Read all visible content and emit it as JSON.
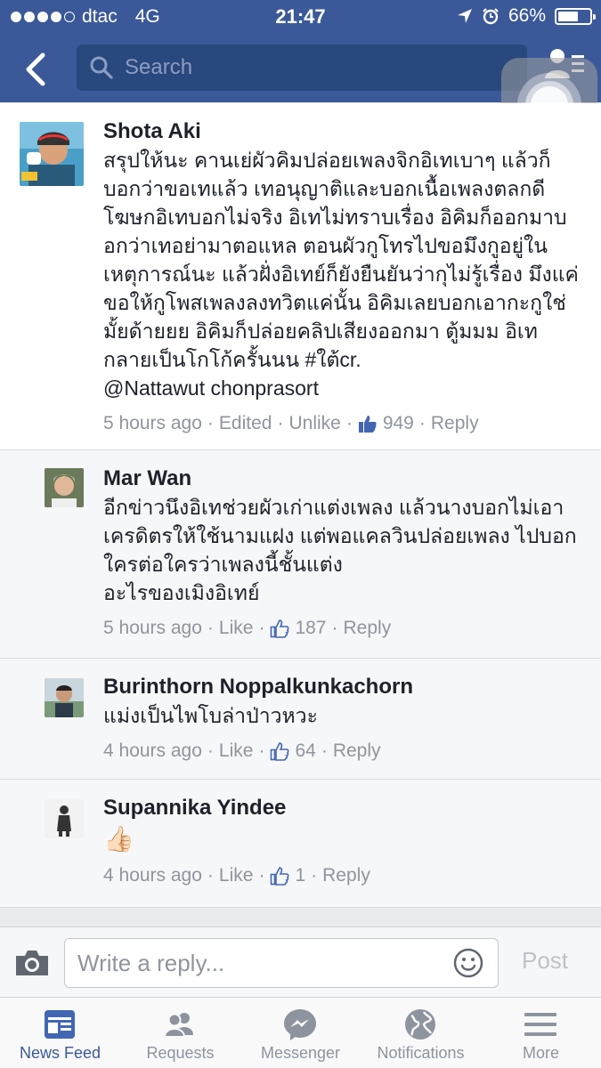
{
  "status_bar": {
    "carrier": "dtac",
    "network": "4G",
    "time": "21:47",
    "battery": "66%",
    "battery_level": 0.66
  },
  "header": {
    "search_placeholder": "Search"
  },
  "comments": [
    {
      "author": "Shota Aki",
      "text": "สรุปให้นะ คานเย่ผัวคิมปล่อยเพลงจิกอิเทเบาๆ แล้วก็บอกว่าขอเทแล้ว เทอนุญาติและบอกเนื้อเพลงตลกดี โฆษกอิเทบอกไม่จริง อิเทไม่ทราบเรื่อง อิคิมก็ออกมาบอกว่าเทอย่ามาตอแหล ตอนผัวกูโทรไปขอมึงกูอยู่ในเหตุการณ์นะ แล้วฝั่งอิเทย์ก็ยังยืนยันว่ากุไม่รู้เรื่อง มึงแค่ขอให้กูโพสเพลงลงทวิตแค่นั้น อิคิมเลยบอกเอากะกูใช่มั้ยด้ายยย อิคิมก็ปล่อยคลิปเสียงออกมา ตู้มมม อิเทกลายเป็นโกโก้ครั้นนน #ใต้cr.",
      "mention": "@Nattawut chonprasort",
      "time": "5 hours ago",
      "edited": "Edited",
      "action": "Unlike",
      "likes": "949",
      "reply": "Reply"
    },
    {
      "author": "Mar Wan",
      "text": "อีกข่าวนึงอิเทช่วยผัวเก่าแต่งเพลง แล้วนางบอกไม่เอาเครดิตรให้ใช้นามแฝง แต่พอแคลวินปล่อยเพลง ไปบอกใครต่อใครว่าเพลงนี้ชั้นแต่ง\nอะไรของเมิงอิเทย์",
      "time": "5 hours ago",
      "action": "Like",
      "likes": "187",
      "reply": "Reply"
    },
    {
      "author": "Burinthorn Noppalkunkachorn",
      "text": "แม่งเป็นไพโบล่าป่าวหวะ",
      "time": "4 hours ago",
      "action": "Like",
      "likes": "64",
      "reply": "Reply"
    },
    {
      "author": "Supannika Yindee",
      "text": "👍🏻",
      "time": "4 hours ago",
      "action": "Like",
      "likes": "1",
      "reply": "Reply"
    }
  ],
  "composer": {
    "placeholder": "Write a reply...",
    "post_label": "Post"
  },
  "tabs": [
    {
      "label": "News Feed",
      "icon": "news-feed-icon",
      "active": true
    },
    {
      "label": "Requests",
      "icon": "friend-requests-icon",
      "active": false
    },
    {
      "label": "Messenger",
      "icon": "messenger-icon",
      "active": false
    },
    {
      "label": "Notifications",
      "icon": "globe-icon",
      "active": false
    },
    {
      "label": "More",
      "icon": "menu-icon",
      "active": false
    }
  ],
  "colors": {
    "brand": "#3b5998",
    "search_bg": "#29487d",
    "meta_text": "#90949c"
  }
}
